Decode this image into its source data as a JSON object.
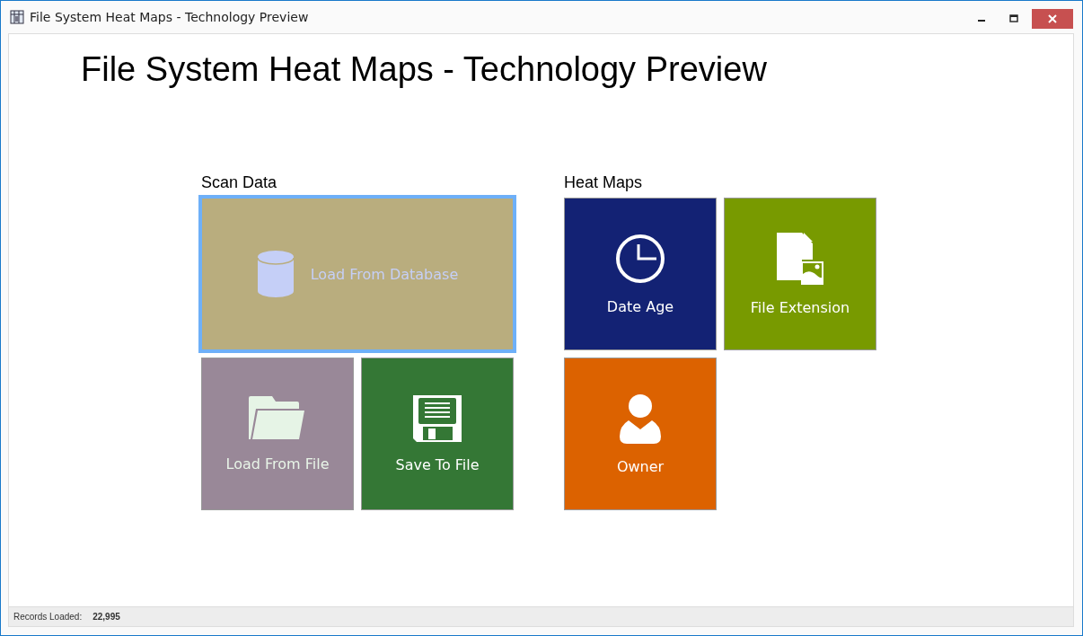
{
  "window": {
    "title": "File System Heat Maps - Technology Preview"
  },
  "heading": "File System Heat Maps - Technology Preview",
  "groups": [
    {
      "label": "Scan Data",
      "tiles": [
        {
          "label": "Load From Database",
          "kind": "database",
          "color": "#b9ad7e",
          "wide": true,
          "selected": true
        },
        {
          "label": "Load From File",
          "kind": "folder",
          "color": "#998898",
          "wide": false,
          "selected": false
        },
        {
          "label": "Save To File",
          "kind": "floppy",
          "color": "#347735",
          "wide": false,
          "selected": false
        }
      ]
    },
    {
      "label": "Heat Maps",
      "tiles": [
        {
          "label": "Date Age",
          "kind": "clock",
          "color": "#132274",
          "wide": false,
          "selected": false
        },
        {
          "label": "File Extension",
          "kind": "file",
          "color": "#789a00",
          "wide": false,
          "selected": false
        },
        {
          "label": "Owner",
          "kind": "person",
          "color": "#dc6200",
          "wide": false,
          "selected": false
        }
      ]
    }
  ],
  "status_bar": {
    "label": "Records Loaded:",
    "value": "22,995"
  }
}
